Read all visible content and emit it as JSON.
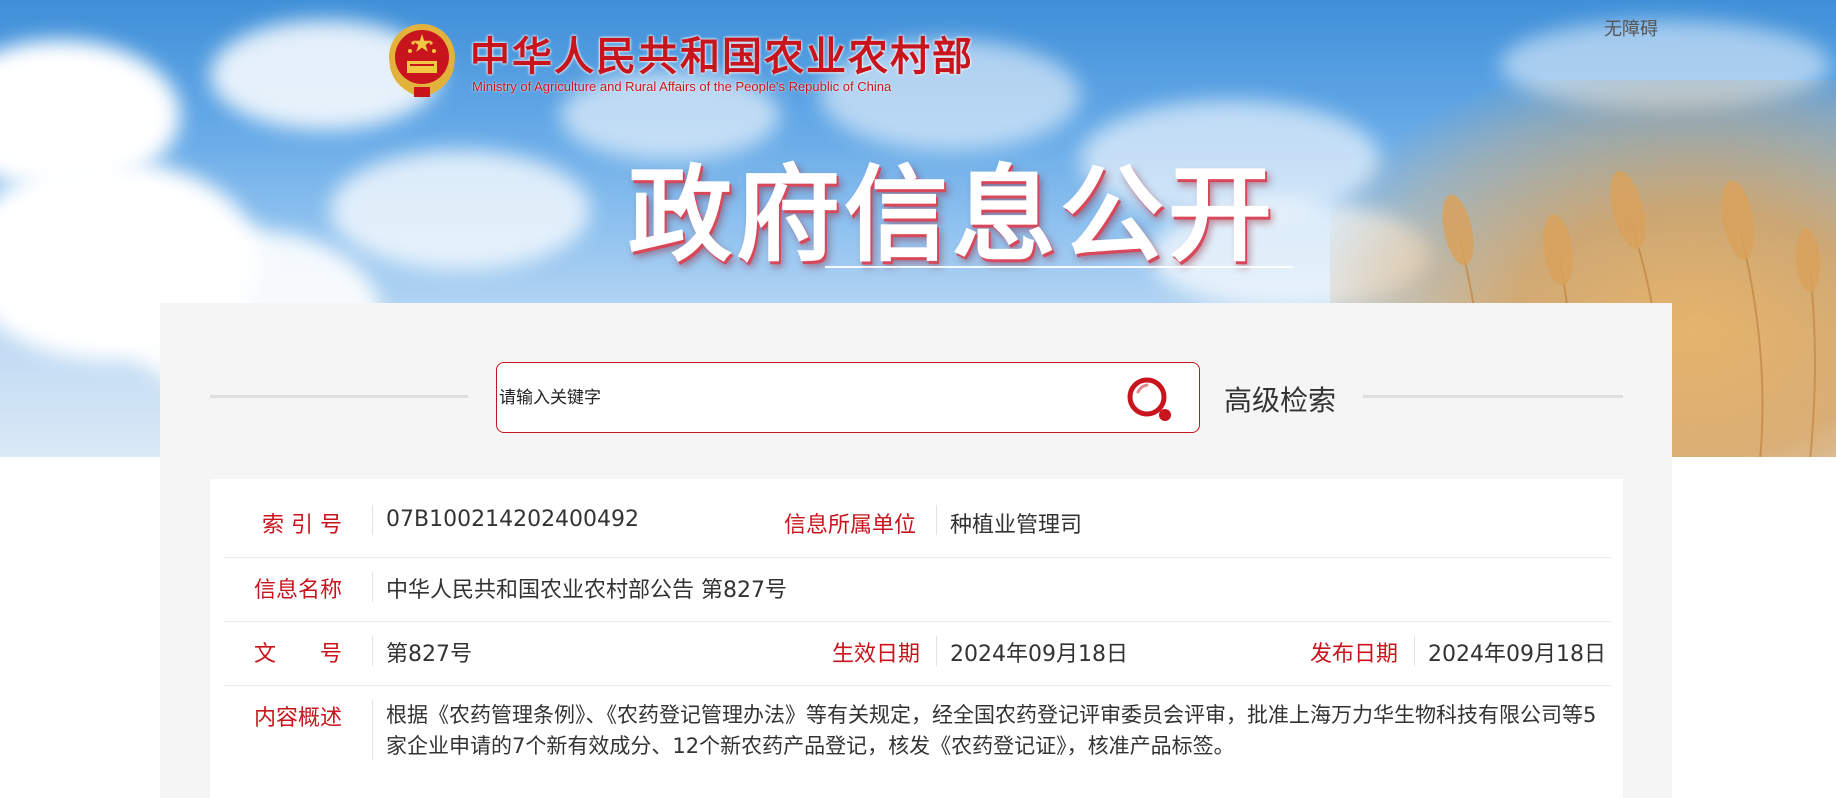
{
  "header": {
    "site_title": "中华人民共和国农业农村部",
    "site_subtitle": "Ministry of Agriculture and Rural Affairs of the People's Republic of China",
    "accessibility_link": "无障碍",
    "hero_title": "政府信息公开"
  },
  "search": {
    "placeholder": "请输入关键字",
    "value": "",
    "icon": "search-icon",
    "advanced_label": "高级检索"
  },
  "info": {
    "index_label": "索 引 号",
    "index_value": "07B100214202400492",
    "unit_label": "信息所属单位",
    "unit_value": "种植业管理司",
    "name_label": "信息名称",
    "name_value": "中华人民共和国农业农村部公告 第827号",
    "doc_no_label": "文　　号",
    "doc_no_value": "第827号",
    "effective_label": "生效日期",
    "effective_value": "2024年09月18日",
    "publish_label": "发布日期",
    "publish_value": "2024年09月18日",
    "summary_label": "内容概述",
    "summary_value": "根据《农药管理条例》、《农药登记管理办法》等有关规定，经全国农药登记评审委员会评审，批准上海万力华生物科技有限公司等5家企业申请的7个新有效成分、12个新农药产品登记，核发《农药登记证》，核准产品标签。"
  },
  "colors": {
    "accent_red": "#c8151d",
    "panel_bg": "#f5f5f5",
    "text": "#333333"
  }
}
